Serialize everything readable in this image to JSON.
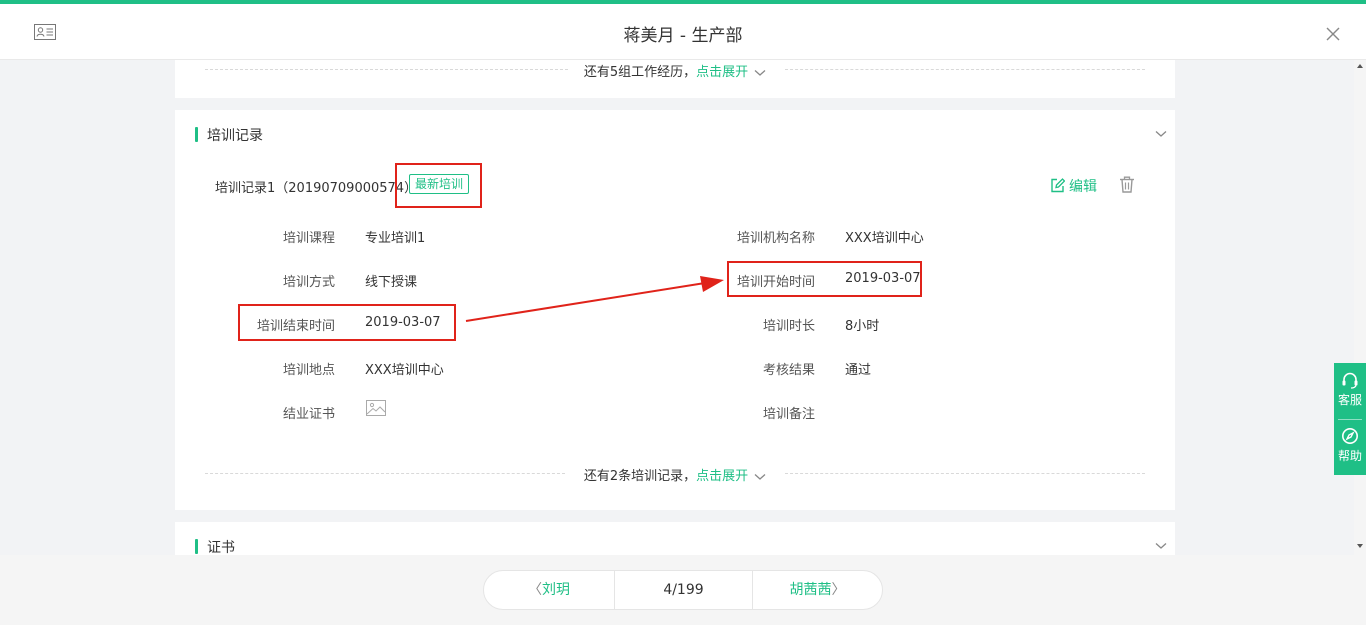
{
  "header": {
    "title": "蒋美月 - 生产部"
  },
  "work_section": {
    "more_text": "还有5组工作经历，",
    "expand_label": "点击展开"
  },
  "training_section": {
    "title": "培训记录",
    "record_title": "培训记录1（20190709000574）",
    "badge": "最新培训",
    "edit_label": "编辑",
    "fields_left": [
      {
        "label": "培训课程",
        "value": "专业培训1"
      },
      {
        "label": "培训方式",
        "value": "线下授课"
      },
      {
        "label": "培训结束时间",
        "value": "2019-03-07"
      },
      {
        "label": "培训地点",
        "value": "XXX培训中心"
      },
      {
        "label": "结业证书",
        "value": ""
      }
    ],
    "fields_right": [
      {
        "label": "培训机构名称",
        "value": "XXX培训中心"
      },
      {
        "label": "培训开始时间",
        "value": "2019-03-07"
      },
      {
        "label": "培训时长",
        "value": "8小时"
      },
      {
        "label": "考核结果",
        "value": "通过"
      },
      {
        "label": "培训备注",
        "value": ""
      }
    ],
    "more_text": "还有2条培训记录，",
    "expand_label": "点击展开"
  },
  "certificate_section": {
    "title": "证书"
  },
  "side_tools": {
    "service_label": "客服",
    "help_label": "帮助"
  },
  "pager": {
    "prev_name": "刘玥",
    "count": "4/199",
    "next_name": "胡茜茜"
  },
  "colors": {
    "accent": "#1fbf86",
    "highlight": "#e0231a"
  },
  "icons": [
    "id-card-icon",
    "close-icon",
    "chevron-down-icon",
    "edit-icon",
    "trash-icon",
    "image-icon",
    "headset-icon",
    "compass-icon",
    "chevron-left-icon",
    "chevron-right-icon"
  ]
}
